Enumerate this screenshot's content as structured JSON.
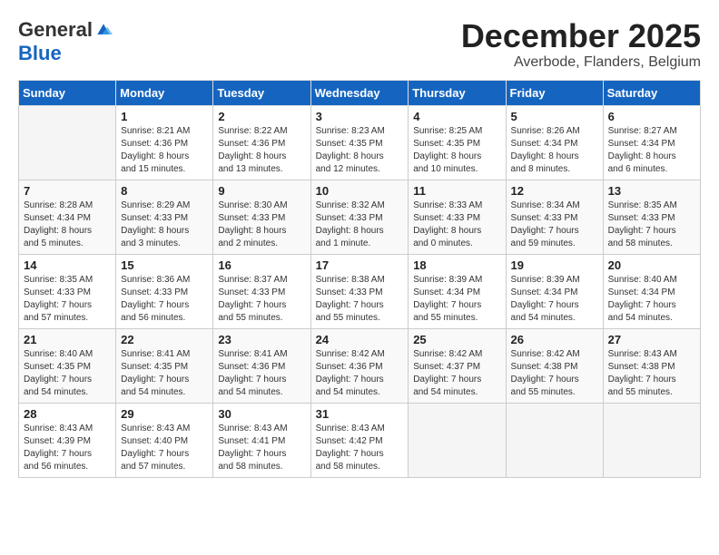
{
  "logo": {
    "general": "General",
    "blue": "Blue"
  },
  "title": {
    "month": "December 2025",
    "location": "Averbode, Flanders, Belgium"
  },
  "headers": [
    "Sunday",
    "Monday",
    "Tuesday",
    "Wednesday",
    "Thursday",
    "Friday",
    "Saturday"
  ],
  "weeks": [
    [
      {
        "day": "",
        "info": ""
      },
      {
        "day": "1",
        "info": "Sunrise: 8:21 AM\nSunset: 4:36 PM\nDaylight: 8 hours\nand 15 minutes."
      },
      {
        "day": "2",
        "info": "Sunrise: 8:22 AM\nSunset: 4:36 PM\nDaylight: 8 hours\nand 13 minutes."
      },
      {
        "day": "3",
        "info": "Sunrise: 8:23 AM\nSunset: 4:35 PM\nDaylight: 8 hours\nand 12 minutes."
      },
      {
        "day": "4",
        "info": "Sunrise: 8:25 AM\nSunset: 4:35 PM\nDaylight: 8 hours\nand 10 minutes."
      },
      {
        "day": "5",
        "info": "Sunrise: 8:26 AM\nSunset: 4:34 PM\nDaylight: 8 hours\nand 8 minutes."
      },
      {
        "day": "6",
        "info": "Sunrise: 8:27 AM\nSunset: 4:34 PM\nDaylight: 8 hours\nand 6 minutes."
      }
    ],
    [
      {
        "day": "7",
        "info": "Sunrise: 8:28 AM\nSunset: 4:34 PM\nDaylight: 8 hours\nand 5 minutes."
      },
      {
        "day": "8",
        "info": "Sunrise: 8:29 AM\nSunset: 4:33 PM\nDaylight: 8 hours\nand 3 minutes."
      },
      {
        "day": "9",
        "info": "Sunrise: 8:30 AM\nSunset: 4:33 PM\nDaylight: 8 hours\nand 2 minutes."
      },
      {
        "day": "10",
        "info": "Sunrise: 8:32 AM\nSunset: 4:33 PM\nDaylight: 8 hours\nand 1 minute."
      },
      {
        "day": "11",
        "info": "Sunrise: 8:33 AM\nSunset: 4:33 PM\nDaylight: 8 hours\nand 0 minutes."
      },
      {
        "day": "12",
        "info": "Sunrise: 8:34 AM\nSunset: 4:33 PM\nDaylight: 7 hours\nand 59 minutes."
      },
      {
        "day": "13",
        "info": "Sunrise: 8:35 AM\nSunset: 4:33 PM\nDaylight: 7 hours\nand 58 minutes."
      }
    ],
    [
      {
        "day": "14",
        "info": "Sunrise: 8:35 AM\nSunset: 4:33 PM\nDaylight: 7 hours\nand 57 minutes."
      },
      {
        "day": "15",
        "info": "Sunrise: 8:36 AM\nSunset: 4:33 PM\nDaylight: 7 hours\nand 56 minutes."
      },
      {
        "day": "16",
        "info": "Sunrise: 8:37 AM\nSunset: 4:33 PM\nDaylight: 7 hours\nand 55 minutes."
      },
      {
        "day": "17",
        "info": "Sunrise: 8:38 AM\nSunset: 4:33 PM\nDaylight: 7 hours\nand 55 minutes."
      },
      {
        "day": "18",
        "info": "Sunrise: 8:39 AM\nSunset: 4:34 PM\nDaylight: 7 hours\nand 55 minutes."
      },
      {
        "day": "19",
        "info": "Sunrise: 8:39 AM\nSunset: 4:34 PM\nDaylight: 7 hours\nand 54 minutes."
      },
      {
        "day": "20",
        "info": "Sunrise: 8:40 AM\nSunset: 4:34 PM\nDaylight: 7 hours\nand 54 minutes."
      }
    ],
    [
      {
        "day": "21",
        "info": "Sunrise: 8:40 AM\nSunset: 4:35 PM\nDaylight: 7 hours\nand 54 minutes."
      },
      {
        "day": "22",
        "info": "Sunrise: 8:41 AM\nSunset: 4:35 PM\nDaylight: 7 hours\nand 54 minutes."
      },
      {
        "day": "23",
        "info": "Sunrise: 8:41 AM\nSunset: 4:36 PM\nDaylight: 7 hours\nand 54 minutes."
      },
      {
        "day": "24",
        "info": "Sunrise: 8:42 AM\nSunset: 4:36 PM\nDaylight: 7 hours\nand 54 minutes."
      },
      {
        "day": "25",
        "info": "Sunrise: 8:42 AM\nSunset: 4:37 PM\nDaylight: 7 hours\nand 54 minutes."
      },
      {
        "day": "26",
        "info": "Sunrise: 8:42 AM\nSunset: 4:38 PM\nDaylight: 7 hours\nand 55 minutes."
      },
      {
        "day": "27",
        "info": "Sunrise: 8:43 AM\nSunset: 4:38 PM\nDaylight: 7 hours\nand 55 minutes."
      }
    ],
    [
      {
        "day": "28",
        "info": "Sunrise: 8:43 AM\nSunset: 4:39 PM\nDaylight: 7 hours\nand 56 minutes."
      },
      {
        "day": "29",
        "info": "Sunrise: 8:43 AM\nSunset: 4:40 PM\nDaylight: 7 hours\nand 57 minutes."
      },
      {
        "day": "30",
        "info": "Sunrise: 8:43 AM\nSunset: 4:41 PM\nDaylight: 7 hours\nand 58 minutes."
      },
      {
        "day": "31",
        "info": "Sunrise: 8:43 AM\nSunset: 4:42 PM\nDaylight: 7 hours\nand 58 minutes."
      },
      {
        "day": "",
        "info": ""
      },
      {
        "day": "",
        "info": ""
      },
      {
        "day": "",
        "info": ""
      }
    ]
  ]
}
